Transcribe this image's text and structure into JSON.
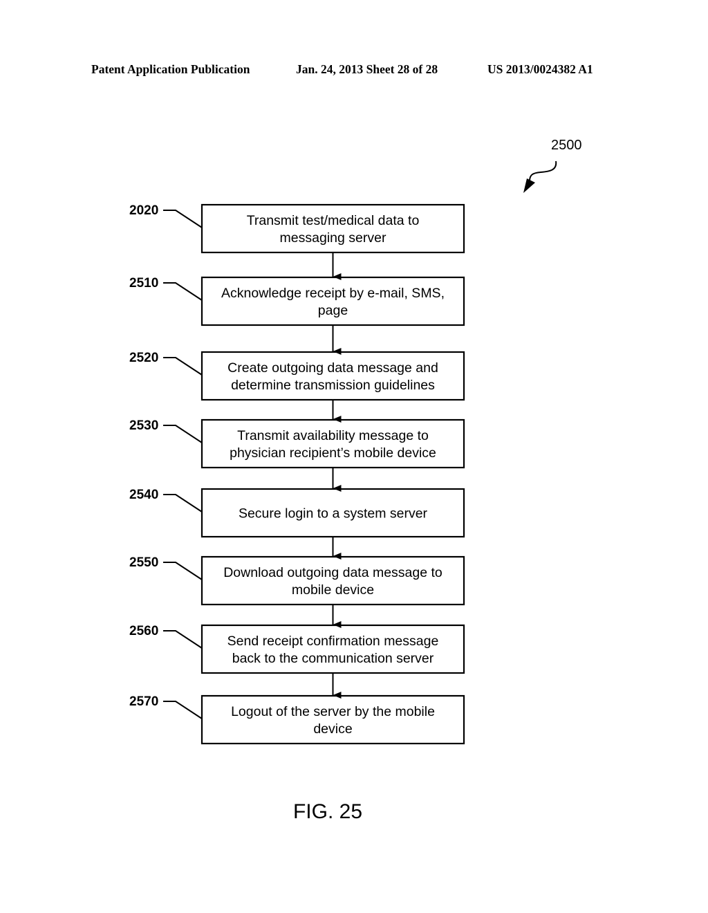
{
  "header": {
    "publication": "Patent Application Publication",
    "date_sheet": "Jan. 24, 2013  Sheet 28 of 28",
    "number": "US 2013/0024382 A1"
  },
  "diagram_ref": "2500",
  "figure_label": "FIG. 25",
  "steps": [
    {
      "ref": "2020",
      "lines": [
        "Transmit test/medical data to",
        "messaging server"
      ]
    },
    {
      "ref": "2510",
      "lines": [
        "Acknowledge receipt by e-mail, SMS,",
        "page"
      ]
    },
    {
      "ref": "2520",
      "lines": [
        "Create outgoing data message and",
        "determine transmission guidelines"
      ]
    },
    {
      "ref": "2530",
      "lines": [
        "Transmit availability message to",
        "physician recipient’s mobile device"
      ]
    },
    {
      "ref": "2540",
      "lines": [
        "Secure login to a system server"
      ]
    },
    {
      "ref": "2550",
      "lines": [
        "Download outgoing data message to",
        "mobile device"
      ]
    },
    {
      "ref": "2560",
      "lines": [
        "Send receipt confirmation message",
        "back to the communication server"
      ]
    },
    {
      "ref": "2570",
      "lines": [
        "Logout of the server by the mobile",
        "device"
      ]
    }
  ]
}
